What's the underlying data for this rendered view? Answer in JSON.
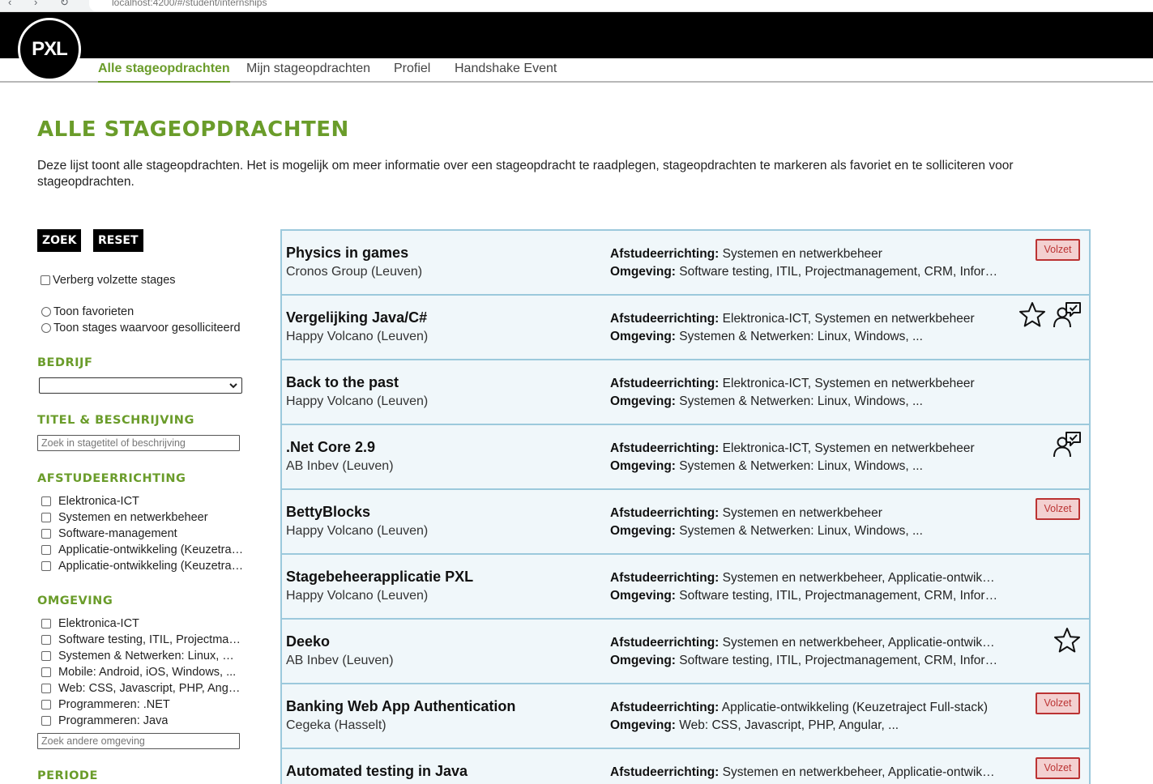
{
  "browser": {
    "url": "localhost:4200/#/student/internships",
    "back_glyph": "‹",
    "forward_glyph": "›",
    "reload_glyph": "↻"
  },
  "brand": {
    "logo_text": "PXL"
  },
  "nav": {
    "tabs": [
      {
        "label": "Alle stageopdrachten",
        "active": true
      },
      {
        "label": "Mijn stageopdrachten",
        "active": false
      },
      {
        "label": "Profiel",
        "active": false
      },
      {
        "label": "Handshake Event",
        "active": false
      }
    ]
  },
  "page": {
    "title": "ALLE STAGEOPDRACHTEN",
    "intro": "Deze lijst toont alle stageopdrachten. Het is mogelijk om meer informatie over een stageopdracht te raadplegen, stageopdrachten te markeren als favoriet en te solliciteren voor stageopdrachten."
  },
  "filters": {
    "search_label": "ZOEK",
    "reset_label": "RESET",
    "hide_full_label": "Verberg volzette stages",
    "show_favorites_label": "Toon favorieten",
    "show_applied_label": "Toon stages waarvoor gesolliciteerd",
    "company": {
      "heading": "BEDRIJF",
      "selected": ""
    },
    "title_desc": {
      "heading": "TITEL & BESCHRIJVING",
      "placeholder": "Zoek in stagetitel of beschrijving"
    },
    "graduation": {
      "heading": "AFSTUDEERRICHTING",
      "options": [
        "Elektronica-ICT",
        "Systemen en netwerkbeheer",
        "Software-management",
        "Applicatie-ontwikkeling (Keuzetraject Full-stack)",
        "Applicatie-ontwikkeling (Keuzetraject Mobile)"
      ]
    },
    "environment": {
      "heading": "OMGEVING",
      "options": [
        "Elektronica-ICT",
        "Software testing, ITIL, Projectmanagement, CRM",
        "Systemen & Netwerken: Linux, Windows, ...",
        "Mobile: Android, iOS, Windows, ...",
        "Web: CSS, Javascript, PHP, Angular, ...",
        "Programmeren: .NET",
        "Programmeren: Java"
      ],
      "placeholder": "Zoek andere omgeving"
    },
    "period": {
      "heading": "PERIODE"
    }
  },
  "labels": {
    "richting": "Afstudeerrichting:",
    "omgeving": "Omgeving:",
    "full_badge": "Volzet"
  },
  "internships": [
    {
      "title": "Physics in games",
      "company": "Cronos Group (Leuven)",
      "richting": "Systemen en netwerkbeheer",
      "omgeving": "Software testing, ITIL, Projectmanagement, CRM, Informatica",
      "full": true,
      "favorite": false,
      "applied": false
    },
    {
      "title": "Vergelijking Java/C#",
      "company": "Happy Volcano (Leuven)",
      "richting": "Elektronica-ICT, Systemen en netwerkbeheer",
      "omgeving": "Systemen & Netwerken: Linux, Windows, ...",
      "full": false,
      "favorite": true,
      "applied": true
    },
    {
      "title": "Back to the past",
      "company": "Happy Volcano (Leuven)",
      "richting": "Elektronica-ICT, Systemen en netwerkbeheer",
      "omgeving": "Systemen & Netwerken: Linux, Windows, ...",
      "full": false,
      "favorite": false,
      "applied": false
    },
    {
      "title": ".Net Core 2.9",
      "company": "AB Inbev (Leuven)",
      "richting": "Elektronica-ICT, Systemen en netwerkbeheer",
      "omgeving": "Systemen & Netwerken: Linux, Windows, ...",
      "full": false,
      "favorite": false,
      "applied": true
    },
    {
      "title": "BettyBlocks",
      "company": "Happy Volcano (Leuven)",
      "richting": "Systemen en netwerkbeheer",
      "omgeving": "Systemen & Netwerken: Linux, Windows, ...",
      "full": true,
      "favorite": false,
      "applied": false
    },
    {
      "title": "Stagebeheerapplicatie PXL",
      "company": "Happy Volcano (Leuven)",
      "richting": "Systemen en netwerkbeheer, Applicatie-ontwikkeling (Keuzetraject Full-stack)",
      "omgeving": "Software testing, ITIL, Projectmanagement, CRM, Informatica",
      "full": false,
      "favorite": false,
      "applied": false
    },
    {
      "title": "Deeko",
      "company": "AB Inbev (Leuven)",
      "richting": "Systemen en netwerkbeheer, Applicatie-ontwikkeling (Keuzetraject Full-stack)",
      "omgeving": "Software testing, ITIL, Projectmanagement, CRM, Informatica",
      "full": false,
      "favorite": true,
      "applied": false
    },
    {
      "title": "Banking Web App Authentication",
      "company": "Cegeka (Hasselt)",
      "richting": "Applicatie-ontwikkeling (Keuzetraject Full-stack)",
      "omgeving": "Web: CSS, Javascript, PHP, Angular, ...",
      "full": true,
      "favorite": false,
      "applied": false
    },
    {
      "title": "Automated testing in Java",
      "company": "",
      "richting": "Systemen en netwerkbeheer, Applicatie-ontwikkeling (Keuzetraject Full-stack)",
      "omgeving": "",
      "full": true,
      "favorite": false,
      "applied": false
    }
  ]
}
